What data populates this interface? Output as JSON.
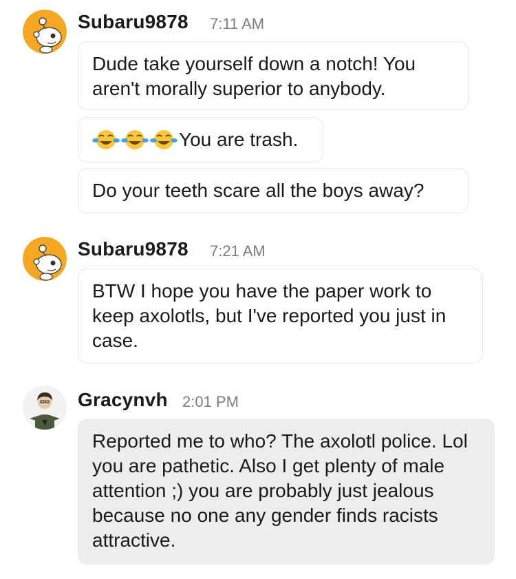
{
  "messages": [
    {
      "username": "Subaru9878",
      "time": "7:11 AM",
      "bubbles": [
        "Dude take yourself down a notch! You aren't morally superior to anybody.",
        "You are trash.",
        "Do your teeth scare all the boys away?"
      ],
      "emoji": "face-with-tears-of-joy-icon"
    },
    {
      "username": "Subaru9878",
      "time": "7:21 AM",
      "bubbles": [
        "BTW I hope you have the paper work to keep axolotls, but I've reported you just in case."
      ]
    },
    {
      "username": "Gracynvh",
      "time": "2:01 PM",
      "bubbles": [
        "Reported me to who? The axolotl police. Lol you are pathetic. Also I get plenty of male attention ;) you are probably just jealous because no one any gender finds racists attractive."
      ]
    }
  ],
  "colors": {
    "snoo_avatar_bg": "#f5a623",
    "own_bubble_bg": "#ecedee",
    "time_text": "#7c7c7c"
  }
}
